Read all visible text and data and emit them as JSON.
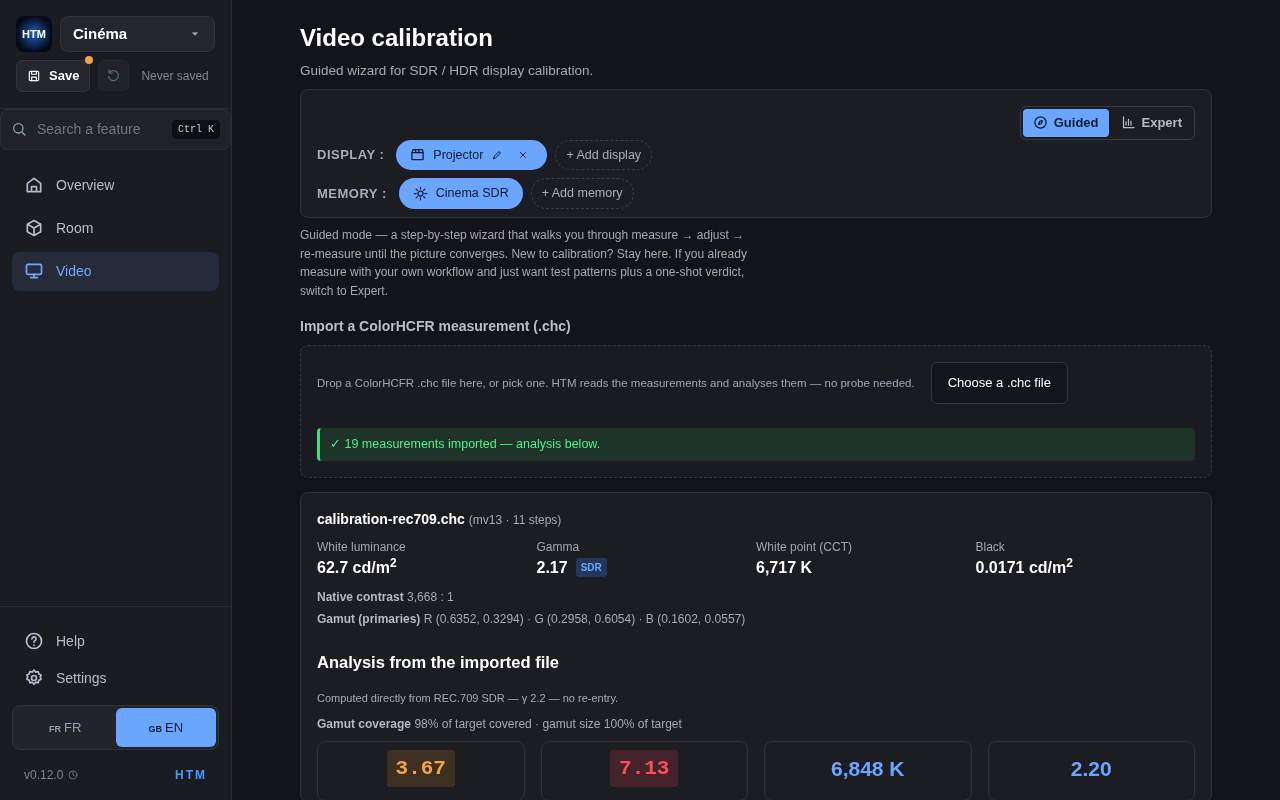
{
  "sidebar": {
    "logo": "HTM",
    "profile": "Cinéma",
    "save": {
      "label": "Save",
      "unsaved": true
    },
    "save_status": "Never saved",
    "search": {
      "placeholder": "Search a feature",
      "shortcut": "Ctrl K"
    },
    "nav": [
      {
        "label": "Overview",
        "selected": false
      },
      {
        "label": "Room",
        "selected": false
      },
      {
        "label": "Video",
        "selected": true
      }
    ],
    "footer_nav": [
      {
        "label": "Help"
      },
      {
        "label": "Settings"
      }
    ],
    "languages": [
      {
        "flag": "FR",
        "label": "FR",
        "selected": false
      },
      {
        "flag": "GB",
        "label": "EN",
        "selected": true
      }
    ],
    "version": "v0.12.0",
    "brand": "HTM"
  },
  "page": {
    "title": "Video calibration",
    "subtitle": "Guided wizard for SDR / HDR display calibration."
  },
  "modes": [
    {
      "label": "Guided",
      "selected": true
    },
    {
      "label": "Expert",
      "selected": false
    }
  ],
  "display": {
    "label": "DISPLAY :",
    "chips": [
      {
        "label": "Projector",
        "editable": true
      }
    ],
    "add": "+ Add display"
  },
  "memory": {
    "label": "MEMORY :",
    "chips": [
      {
        "label": "Cinema SDR",
        "editable": false
      }
    ],
    "add": "+ Add memory"
  },
  "mode_description": "Guided mode — a step-by-step wizard that walks you through measure → adjust → re-measure until the picture converges. New to calibration? Stay here. If you already measure with your own workflow and just want test patterns plus a one-shot verdict, switch to Expert.",
  "import": {
    "heading": "Import a ColorHCFR measurement (.chc)",
    "hint": "Drop a ColorHCFR .chc file here, or pick one. HTM reads the measurements and analyses them — no probe needed.",
    "button": "Choose a .chc file",
    "status": "✓ 19 measurements imported — analysis below."
  },
  "file": {
    "name": "calibration-rec709.chc",
    "meta": "(mv13 · 11 steps)",
    "metrics": [
      {
        "label": "White luminance",
        "value": "62.7 cd/m$^{2}$"
      },
      {
        "label": "Gamma",
        "value": "2.17",
        "badge": "SDR"
      },
      {
        "label": "White point (CCT)",
        "value": "6,717 K"
      },
      {
        "label": "Black",
        "value": "0.0171 cd/m$^{2}$"
      }
    ],
    "details": [
      "**Native contrast** 3,668 : 1",
      "**Gamut (primaries)** R (0.6352, 0.3294) · G (0.2958, 0.6054) · B (0.1602, 0.0557)"
    ],
    "analysis_title": "Analysis from the imported file",
    "analysis_note": "Computed directly from REC.709 SDR — γ 2.2 — no re-entry.",
    "coverage": "**Gamut coverage** 98% of target covered · gamut size 100% of target",
    "stats": [
      {
        "value": "3.67",
        "kind": "warn"
      },
      {
        "value": "7.13",
        "kind": "bad"
      },
      {
        "value": "6,848 K",
        "kind": "info"
      },
      {
        "value": "2.20",
        "kind": "info"
      }
    ]
  }
}
